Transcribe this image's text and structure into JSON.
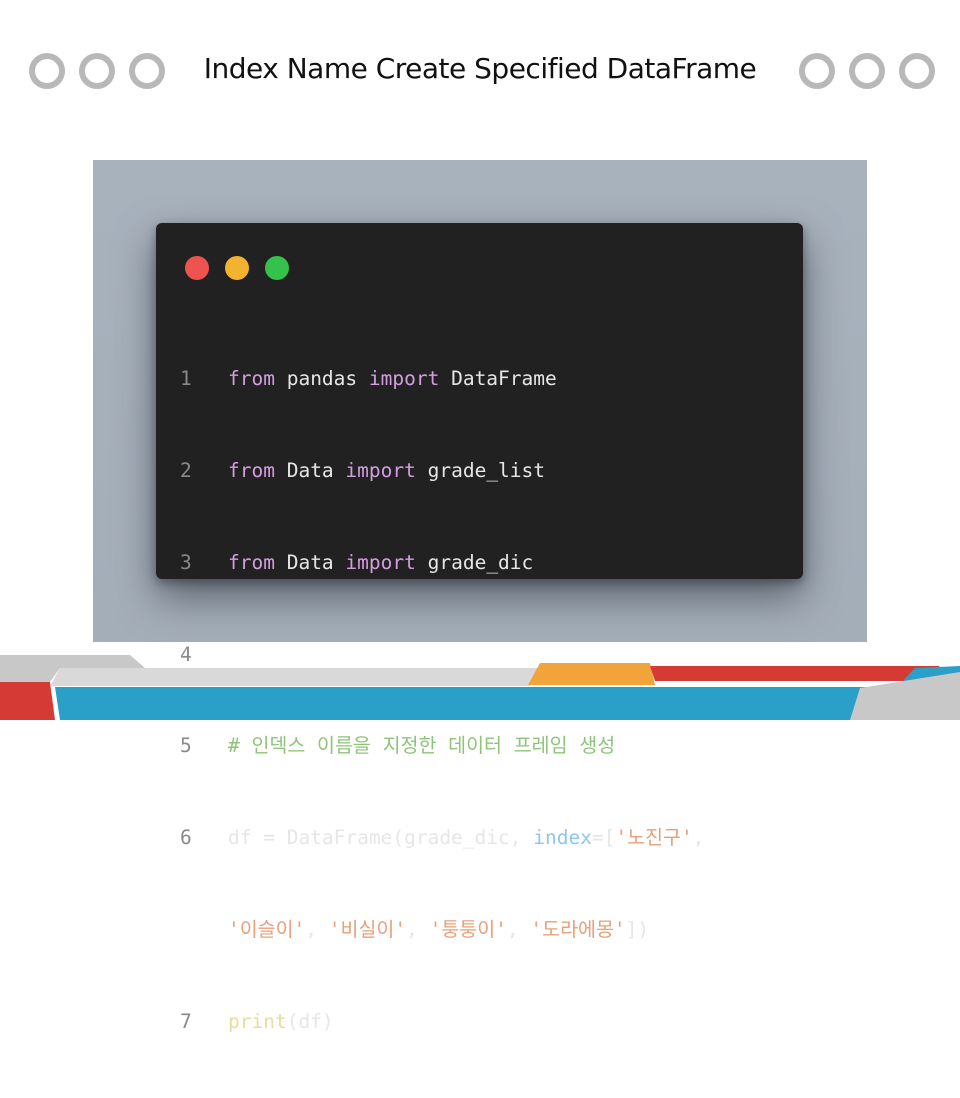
{
  "slide": {
    "title": "Index Name Create Specified DataFrame"
  },
  "window_controls": {
    "colors": [
      "#ef5350",
      "#f4b32e",
      "#35c24a"
    ]
  },
  "code": {
    "line1": {
      "num": "1",
      "t1": "from",
      "t2": " pandas ",
      "t3": "import",
      "t4": " DataFrame"
    },
    "line2": {
      "num": "2",
      "t1": "from",
      "t2": " Data ",
      "t3": "import",
      "t4": " grade_list"
    },
    "line3": {
      "num": "3",
      "t1": "from",
      "t2": " Data ",
      "t3": "import",
      "t4": " grade_dic"
    },
    "line4": {
      "num": "4"
    },
    "line5": {
      "num": "5",
      "comment": "# 인덱스 이름을 지정한 데이터 프레임 생성"
    },
    "line6": {
      "num": "6",
      "t1": "df = DataFrame(grade_dic, ",
      "t2": "index",
      "t3": "=[",
      "t4": "'노진구'",
      "t5": ","
    },
    "line6b": {
      "s1": "'이슬이'",
      "c1": ", ",
      "s2": "'비실이'",
      "c2": ", ",
      "s3": "'퉁퉁이'",
      "c3": ", ",
      "s4": "'도라에몽'",
      "end": "])"
    },
    "line7": {
      "num": "7",
      "t1": "print",
      "t2": "(df)"
    }
  },
  "colors": {
    "editor_bg": "#212121",
    "panel_bg": "#a8b2bd",
    "keyword": "#d49de0",
    "string": "#e7a07a",
    "comment": "#8ec47a"
  }
}
